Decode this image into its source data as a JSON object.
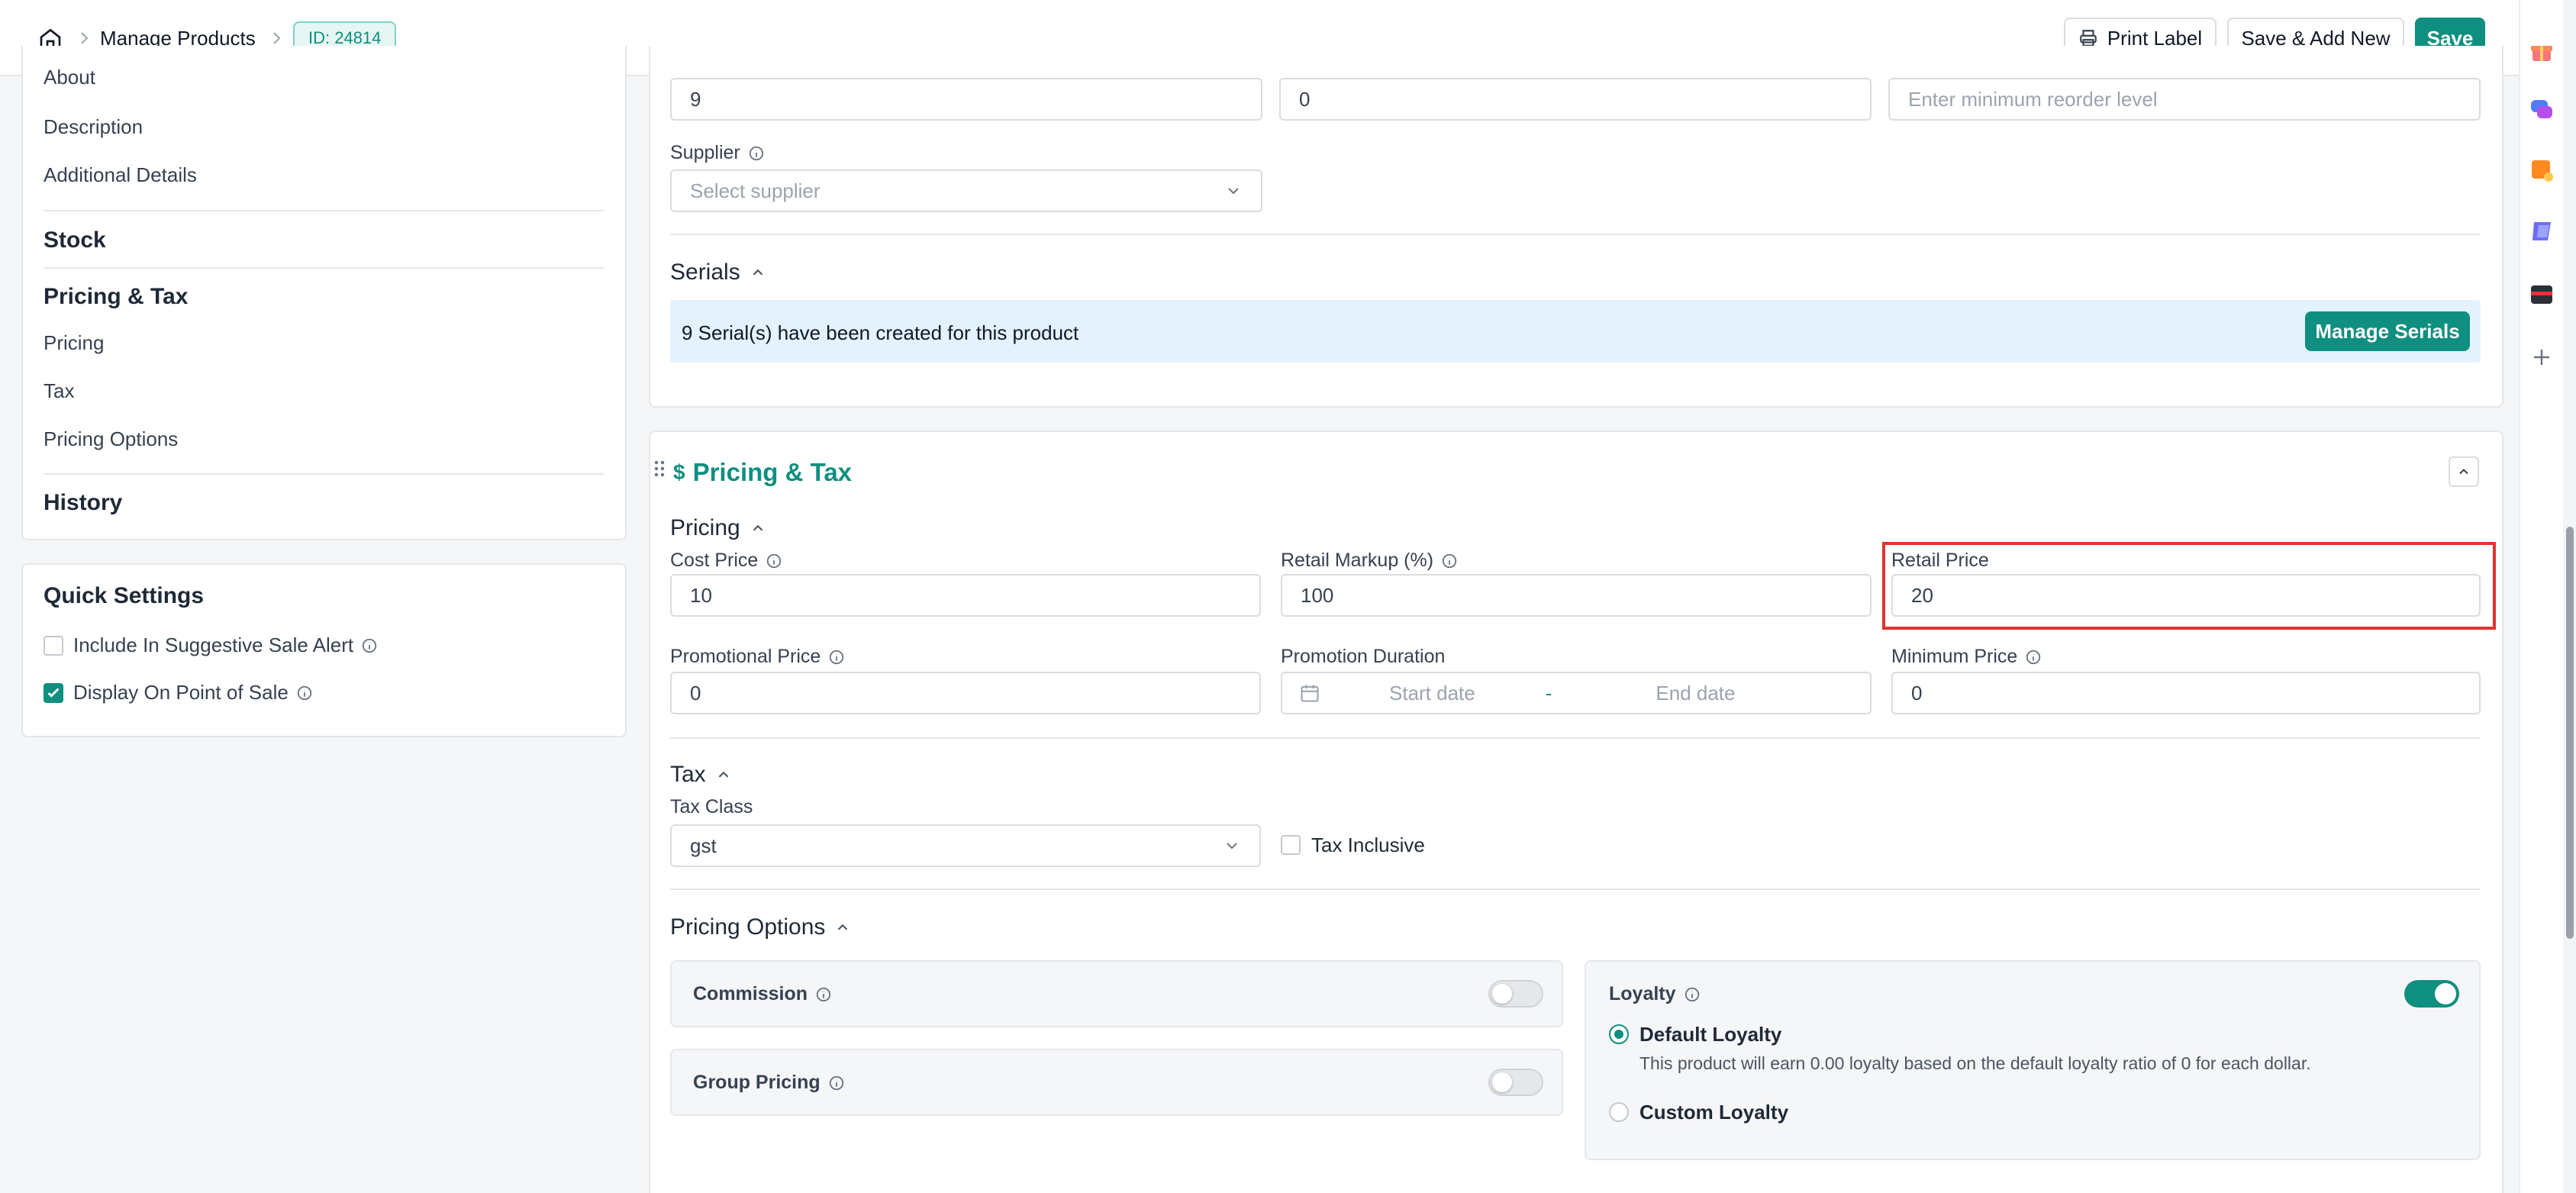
{
  "header": {
    "breadcrumb_title": "Manage Products",
    "id_badge": "ID: 24814",
    "print_label": "Print Label",
    "save_add_new": "Save & Add New",
    "save": "Save"
  },
  "sidebar": {
    "items_top": [
      "About",
      "Description",
      "Additional Details"
    ],
    "stock": "Stock",
    "pricing_tax": "Pricing & Tax",
    "pricing_items": [
      "Pricing",
      "Tax",
      "Pricing Options"
    ],
    "history": "History"
  },
  "quick_settings": {
    "title": "Quick Settings",
    "include_suggestive": "Include In Suggestive Sale Alert",
    "include_suggestive_checked": false,
    "display_pos": "Display On Point of Sale",
    "display_pos_checked": true
  },
  "stock": {
    "field1_value": "9",
    "field2_value": "0",
    "reorder_placeholder": "Enter minimum reorder level",
    "supplier_label": "Supplier",
    "supplier_placeholder": "Select supplier"
  },
  "serials": {
    "title": "Serials",
    "message": "9 Serial(s) have been created for this product",
    "manage_button": "Manage Serials"
  },
  "pricing_tax": {
    "section_title": "Pricing & Tax",
    "pricing_title": "Pricing",
    "cost_price_label": "Cost Price",
    "cost_price": "10",
    "retail_markup_label": "Retail Markup (%)",
    "retail_markup": "100",
    "retail_price_label": "Retail Price",
    "retail_price": "20",
    "promo_price_label": "Promotional Price",
    "promo_price": "0",
    "promo_duration_label": "Promotion Duration",
    "start_date_placeholder": "Start date",
    "date_separator": "-",
    "end_date_placeholder": "End date",
    "min_price_label": "Minimum Price",
    "min_price": "0",
    "tax_title": "Tax",
    "tax_class_label": "Tax Class",
    "tax_class": "gst",
    "tax_inclusive_label": "Tax Inclusive",
    "tax_inclusive_checked": false
  },
  "pricing_options": {
    "title": "Pricing Options",
    "commission_label": "Commission",
    "commission_on": false,
    "group_pricing_label": "Group Pricing",
    "group_pricing_on": false,
    "loyalty_label": "Loyalty",
    "loyalty_on": true,
    "default_loyalty_label": "Default Loyalty",
    "default_loyalty_desc": "This product will earn 0.00 loyalty based on the default loyalty ratio of 0 for each dollar.",
    "custom_loyalty_label": "Custom Loyalty",
    "selected_loyalty": "default"
  },
  "colors": {
    "accent": "#0f8f7f",
    "highlight_border": "#e0342f",
    "serial_banner": "#e3f2fc"
  }
}
